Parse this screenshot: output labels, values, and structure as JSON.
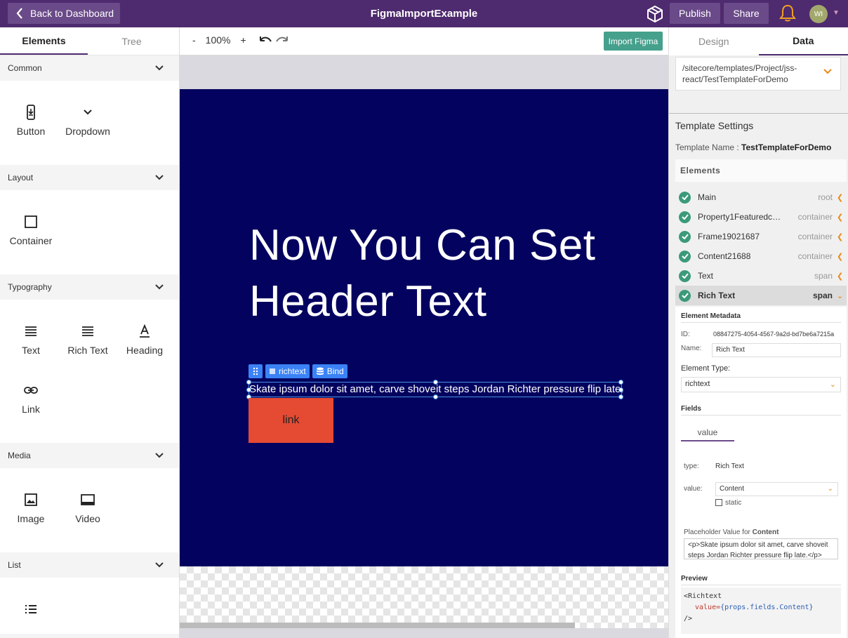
{
  "header": {
    "back_label": "Back to Dashboard",
    "app_title": "FigmaImportExample",
    "publish_label": "Publish",
    "share_label": "Share",
    "avatar_initials": "WI"
  },
  "left_panel": {
    "tabs": [
      {
        "label": "Elements"
      },
      {
        "label": "Tree"
      }
    ],
    "sections": [
      {
        "title": "Common",
        "items": [
          {
            "label": "Button",
            "icon": "button-icon"
          },
          {
            "label": "Dropdown",
            "icon": "chevron-down-icon"
          }
        ]
      },
      {
        "title": "Layout",
        "items": [
          {
            "label": "Container",
            "icon": "square-icon"
          }
        ]
      },
      {
        "title": "Typography",
        "items": [
          {
            "label": "Text",
            "icon": "text-lines-icon"
          },
          {
            "label": "Rich Text",
            "icon": "rich-text-icon"
          },
          {
            "label": "Heading",
            "icon": "heading-icon"
          },
          {
            "label": "Link",
            "icon": "link-icon"
          }
        ]
      },
      {
        "title": "Media",
        "items": [
          {
            "label": "Image",
            "icon": "image-icon"
          },
          {
            "label": "Video",
            "icon": "video-icon"
          }
        ]
      },
      {
        "title": "List",
        "items": []
      }
    ]
  },
  "toolbar": {
    "zoom_minus": "-",
    "zoom_level": "100%",
    "zoom_plus": "+",
    "import_label": "Import Figma"
  },
  "canvas": {
    "hero_text": "Now You Can Set Header Text",
    "sel_tag_label": "richtext",
    "bind_label": "Bind",
    "rich_text": "Skate ipsum dolor sit amet, carve shoveit steps Jordan Richter pressure flip late.",
    "link_label": "link",
    "stage_color": "#03035f",
    "link_color": "#e54a33"
  },
  "right_panel": {
    "tabs": [
      {
        "label": "Design"
      },
      {
        "label": "Data"
      }
    ],
    "template_path": "/sitecore/templates/Project/jss-react/TestTemplateForDemo",
    "settings_title": "Template Settings",
    "template_name_label": "Template Name :",
    "template_name": "TestTemplateForDemo",
    "elements_title": "Elements",
    "elements": [
      {
        "name": "Main",
        "type": "root"
      },
      {
        "name": "Property1Featuredco...",
        "type": "container"
      },
      {
        "name": "Frame19021687",
        "type": "container"
      },
      {
        "name": "Content21688",
        "type": "container"
      },
      {
        "name": "Text",
        "type": "span"
      },
      {
        "name": "Rich Text",
        "type": "span"
      }
    ],
    "metadata": {
      "title": "Element Metadata",
      "id_label": "ID:",
      "id_value": "08847275-4054-4567-9a2d-bd7be6a7215a",
      "name_label": "Name:",
      "name_value": "Rich Text",
      "element_type_label": "Element Type:",
      "element_type_value": "richtext",
      "fields_title": "Fields",
      "field_tab": "value",
      "type_label": "type:",
      "type_value": "Rich Text",
      "value_label": "value:",
      "value_value": "Content",
      "static_label": "static",
      "placeholder_label": "Placeholder Value for",
      "placeholder_field": "Content",
      "placeholder_text": "<p>Skate ipsum dolor sit amet, carve shoveit steps Jordan Richter pressure flip late.</p>",
      "preview_title": "Preview",
      "preview_line1": "<Richtext",
      "preview_prop": "value=",
      "preview_val": "{props.fields.Content}",
      "preview_line3": "/>"
    },
    "accent_color": "#e88b1b",
    "check_color": "#3b9a79"
  }
}
